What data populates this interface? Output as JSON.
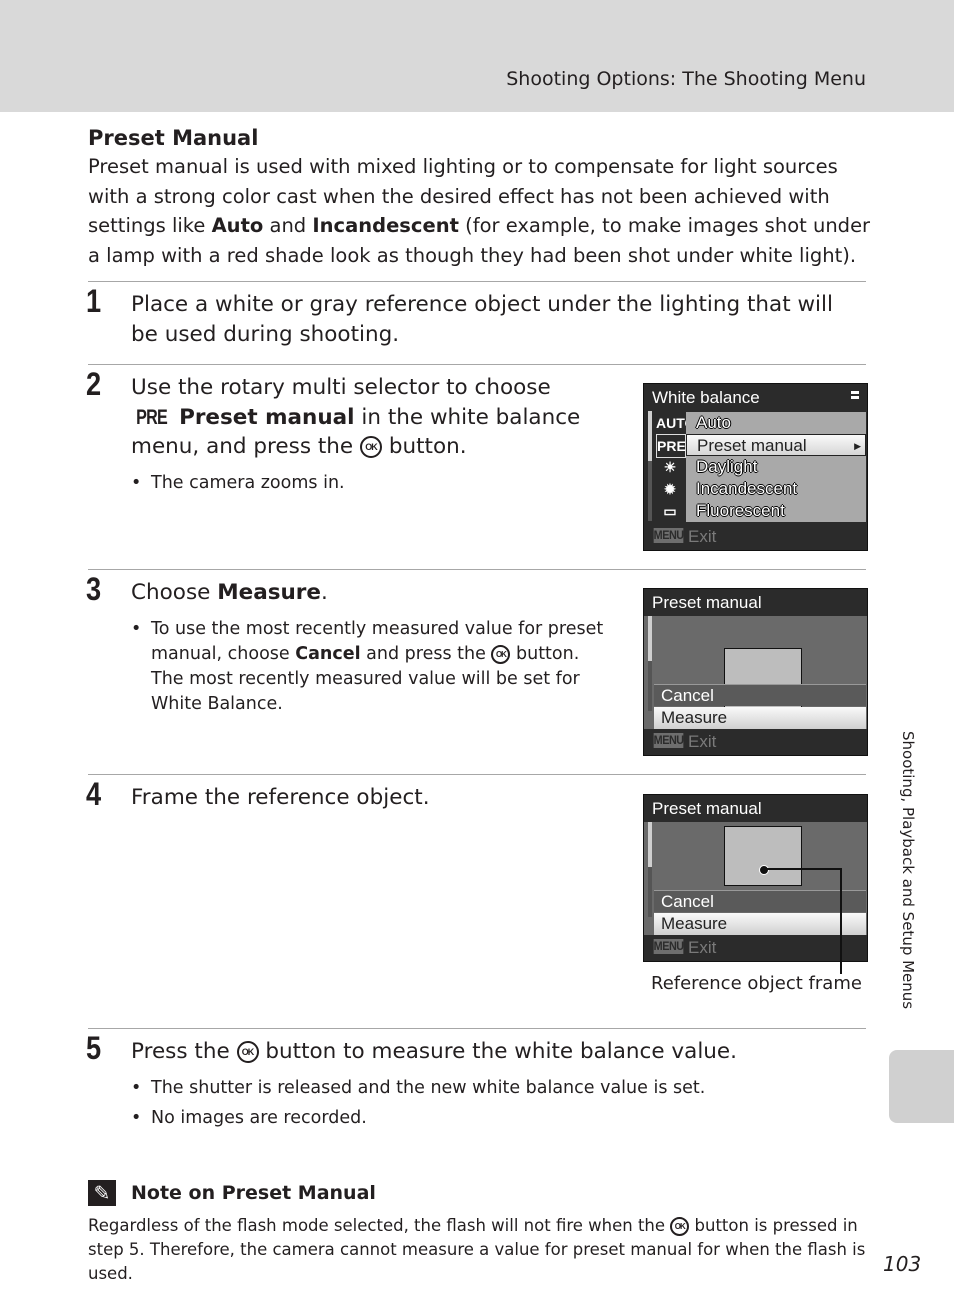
{
  "header": {
    "title": "Shooting Options: The Shooting Menu"
  },
  "section": {
    "title": "Preset Manual",
    "intro_parts": [
      "Preset manual is used with mixed lighting or to compensate for light sources with a strong color cast when the desired effect has not been achieved with settings like ",
      "Auto",
      " and ",
      "Incandescent",
      " (for example, to make images shot under a lamp with a red shade look as though they had been shot under white light)."
    ]
  },
  "steps": [
    {
      "number": "1",
      "text": "Place a white or gray reference object under the lighting that will be used during shooting."
    },
    {
      "number": "2",
      "text_a": "Use the rotary multi selector to choose",
      "pre_icon": "PRE",
      "bold": "Preset manual",
      "text_b": " in the white balance menu, and press the ",
      "ok_icon": "OK",
      "text_c": " button.",
      "bullets": [
        "The camera zooms in."
      ]
    },
    {
      "number": "3",
      "text_a": "Choose ",
      "bold": "Measure",
      "text_b": ".",
      "bullet_parts": [
        "To use the most recently measured value for preset manual, choose ",
        "Cancel",
        " and press the ",
        "OK",
        " button. The most recently measured value will be set for White Balance."
      ]
    },
    {
      "number": "4",
      "text": "Frame the reference object."
    },
    {
      "number": "5",
      "text_a": "Press the ",
      "ok_icon": "OK",
      "text_b": " button to measure the white balance value.",
      "bullets": [
        "The shutter is released and the new white balance value is set.",
        "No images are recorded."
      ]
    }
  ],
  "screens": {
    "white_balance": {
      "title": "White balance",
      "items": [
        {
          "icon": "AUTO",
          "label": "Auto"
        },
        {
          "icon": "PRE",
          "label": "Preset manual",
          "selected": true
        },
        {
          "icon": "☀",
          "label": "Daylight"
        },
        {
          "icon": "✹",
          "label": "Incandescent"
        },
        {
          "icon": "▭",
          "label": "Fluorescent"
        }
      ],
      "footer_badge": "MENU",
      "footer_label": "Exit"
    },
    "preset_manual_1": {
      "title": "Preset manual",
      "items": [
        "Cancel",
        "Measure"
      ],
      "selected": "Measure",
      "footer_badge": "MENU",
      "footer_label": "Exit"
    },
    "preset_manual_2": {
      "title": "Preset manual",
      "items": [
        "Cancel",
        "Measure"
      ],
      "selected": "Measure",
      "footer_badge": "MENU",
      "footer_label": "Exit",
      "callout": "Reference object frame"
    }
  },
  "note": {
    "icon": "paperclip-icon",
    "title": "Note on Preset Manual",
    "body_a": "Regardless of the flash mode selected, the flash will not fire when the ",
    "ok_icon": "OK",
    "body_b": " button is pressed in step 5. Therefore, the camera cannot measure a value for preset manual for when the flash is used."
  },
  "side_tab": {
    "label": "Shooting, Playback and Setup Menus"
  },
  "page_number": "103"
}
